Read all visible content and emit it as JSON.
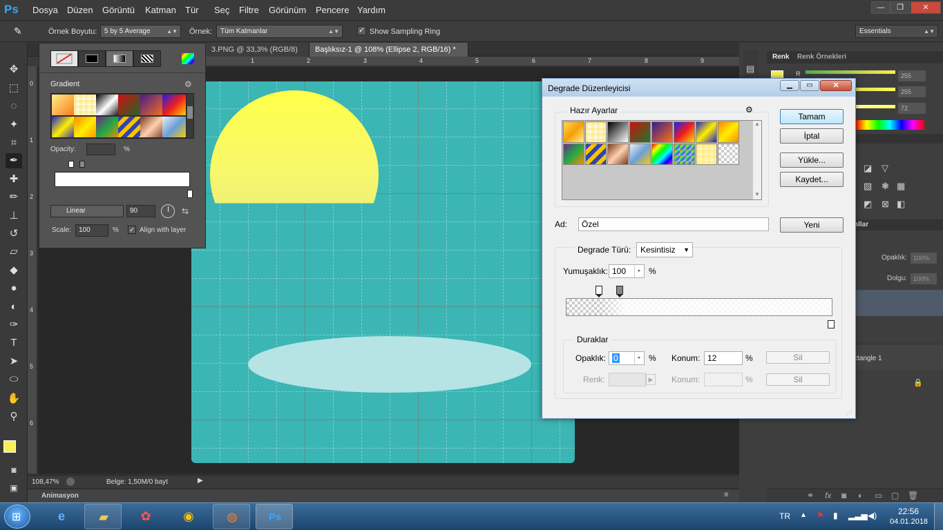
{
  "app": {
    "logo": "Ps",
    "menu": [
      "Dosya",
      "Düzen",
      "Görüntü",
      "Katman",
      "Tür",
      "Seç",
      "Filtre",
      "Görünüm",
      "Pencere",
      "Yardım"
    ],
    "window_buttons": [
      "—",
      "❐",
      "✕"
    ]
  },
  "options": {
    "sample_size_label": "Örnek Boyutu:",
    "sample_size_value": "5 by 5 Average",
    "sample_label": "Örnek:",
    "sample_value": "Tüm Katmanlar",
    "show_ring_label": "Show Sampling Ring",
    "workspace": "Essentials"
  },
  "tabs": [
    {
      "label": "3.PNG @ 33,3% (RGB/8)",
      "close": "✕"
    },
    {
      "label": "Başlıksız-1 @ 108% (Ellipse 2, RGB/16) *",
      "close": "✕"
    }
  ],
  "ruler_h": [
    "1",
    "2",
    "3",
    "4",
    "5",
    "6",
    "7",
    "8",
    "9"
  ],
  "ruler_v": [
    "0",
    "1",
    "2",
    "3",
    "4",
    "5",
    "6"
  ],
  "gradient_panel": {
    "title": "Gradient",
    "opacity_label": "Opacity:",
    "percent": "%",
    "type_value": "Linear",
    "angle_value": "90",
    "scale_label": "Scale:",
    "scale_value": "100",
    "align_label": "Align with layer"
  },
  "status": {
    "zoom": "108,47%",
    "doc_info": "Belge: 1,50M/0 bayt"
  },
  "animation_label": "Animasyon",
  "right": {
    "tab_color": "Renk",
    "tab_swatches": "Renk Örnekleri",
    "r_label": "R",
    "slider_values": [
      "255",
      "255",
      "72"
    ],
    "layers_tab_partial": "ollar",
    "opacity_label": "Opaklık:",
    "opacity_value": "100%",
    "fill_label": "Dolgu:",
    "fill_value": "100%",
    "layer_name_partial": "ctangle 1"
  },
  "dialog": {
    "title": "Degrade Düzenleyicisi",
    "presets_label": "Hazır Ayarlar",
    "ok": "Tamam",
    "cancel": "İptal",
    "load": "Yükle...",
    "save": "Kaydet...",
    "name_label": "Ad:",
    "name_value": "Özel",
    "new": "Yeni",
    "type_label": "Degrade Türü:",
    "type_value": "Kesintisiz",
    "smooth_label": "Yumuşaklık:",
    "smooth_value": "100",
    "percent": "%",
    "stops_label": "Duraklar",
    "opacity_label": "Opaklık:",
    "opacity_value": "0",
    "location_label": "Konum:",
    "location_value": "12",
    "delete": "Sil",
    "color_label": "Renk:",
    "location2_label": "Konum:",
    "delete2": "Sil"
  },
  "taskbar": {
    "lang": "TR",
    "time": "22:56",
    "date": "04.01.2018"
  },
  "colors": {
    "canvas": "#3bb6b4",
    "foreground": "#f7f05a",
    "background": "#d98b3a"
  }
}
